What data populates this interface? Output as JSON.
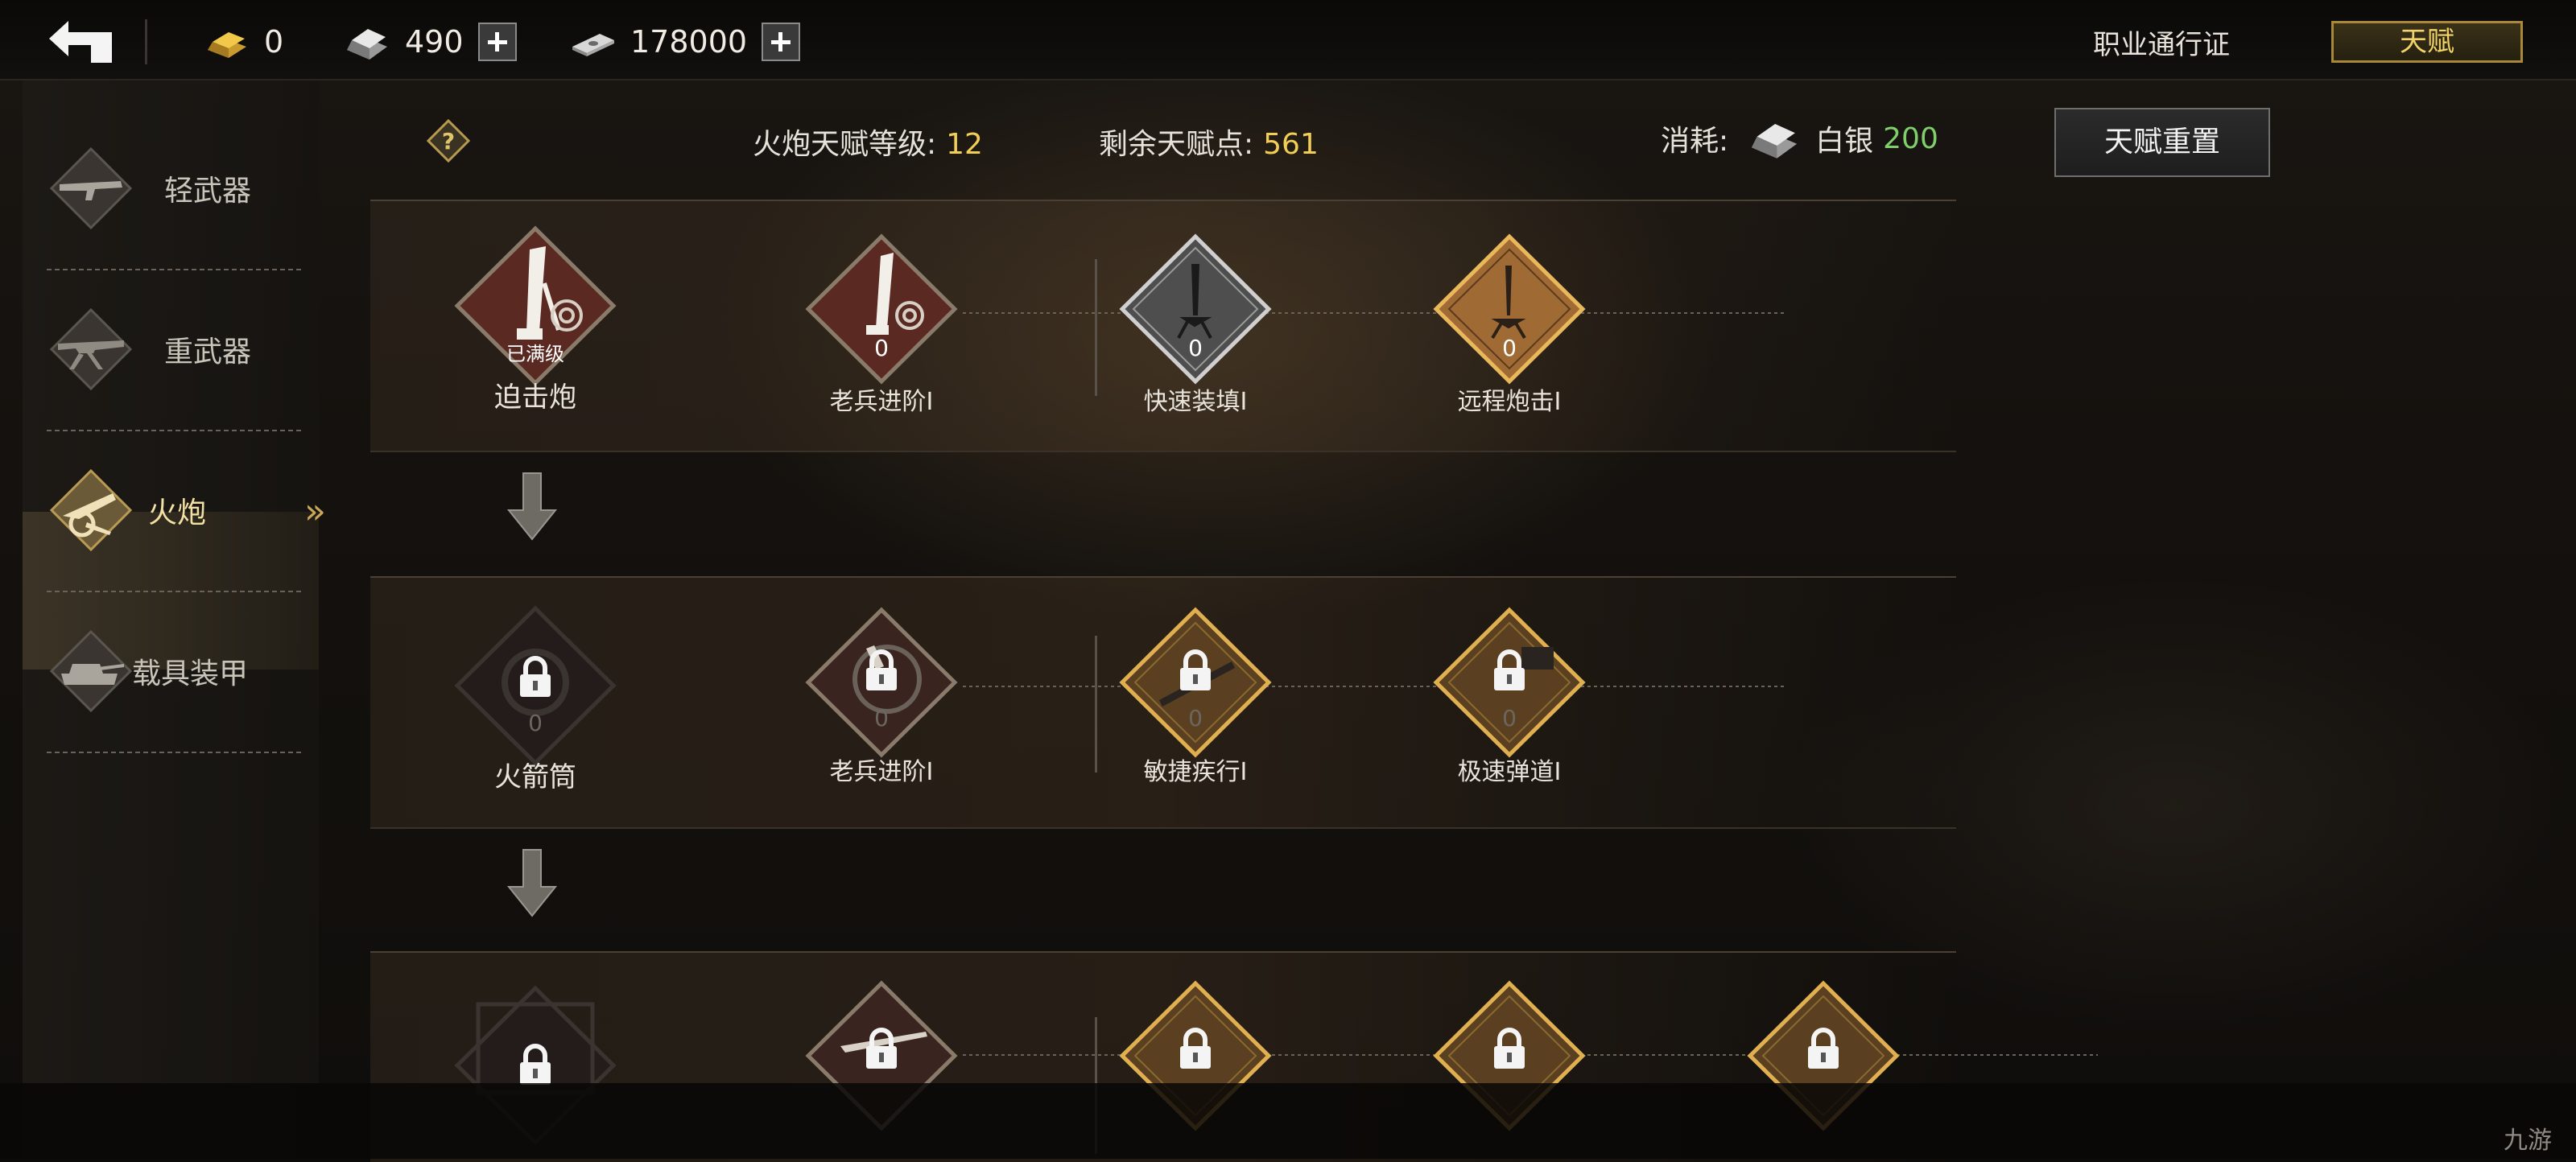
{
  "topbar": {
    "currencies": [
      {
        "icon": "gold-bar-icon",
        "value": "0",
        "has_plus": false
      },
      {
        "icon": "silver-bar-icon",
        "value": "490",
        "has_plus": true
      },
      {
        "icon": "banknote-icon",
        "value": "178000",
        "has_plus": true
      }
    ],
    "pass_label": "职业通行证",
    "talent_tab_label": "天赋"
  },
  "sidebar": {
    "items": [
      {
        "label": "轻武器",
        "icon": "rifle-icon",
        "active": false
      },
      {
        "label": "重武器",
        "icon": "machine-gun-icon",
        "active": false
      },
      {
        "label": "火炮",
        "icon": "cannon-icon",
        "active": true
      },
      {
        "label": "载具装甲",
        "icon": "tank-icon",
        "active": false
      }
    ]
  },
  "header": {
    "level_label": "火炮天赋等级:",
    "level_value": "12",
    "points_label": "剩余天赋点:",
    "points_value": "561",
    "cost_label": "消耗:",
    "cost_currency": "白银",
    "cost_value": "200",
    "reset_label": "天赋重置"
  },
  "rows": [
    {
      "main": {
        "name": "迫击炮",
        "badge": "已满级",
        "locked": false
      },
      "talents": [
        {
          "name": "老兵进阶I",
          "count": "0",
          "style": "red",
          "locked": false
        },
        {
          "name": "快速装填I",
          "count": "0",
          "style": "silver",
          "locked": false
        },
        {
          "name": "远程炮击I",
          "count": "0",
          "style": "gold",
          "locked": false
        }
      ]
    },
    {
      "main": {
        "name": "火箭筒",
        "count": "0",
        "locked": true
      },
      "talents": [
        {
          "name": "老兵进阶I",
          "count": "0",
          "style": "red",
          "locked": true
        },
        {
          "name": "敏捷疾行I",
          "count": "0",
          "style": "gold",
          "locked": true
        },
        {
          "name": "极速弹道I",
          "count": "0",
          "style": "gold",
          "locked": true
        }
      ]
    },
    {
      "main": {
        "name": "",
        "locked": true
      },
      "talents": [
        {
          "name": "",
          "style": "red",
          "locked": true
        },
        {
          "name": "",
          "style": "gold",
          "locked": true
        },
        {
          "name": "",
          "style": "gold",
          "locked": true
        },
        {
          "name": "",
          "style": "gold",
          "locked": true
        }
      ]
    }
  ],
  "watermark": "九游",
  "colors": {
    "accent_gold": "#f2cf54",
    "cost_green": "#7fcf6a",
    "red_node": "#5a2a22"
  }
}
